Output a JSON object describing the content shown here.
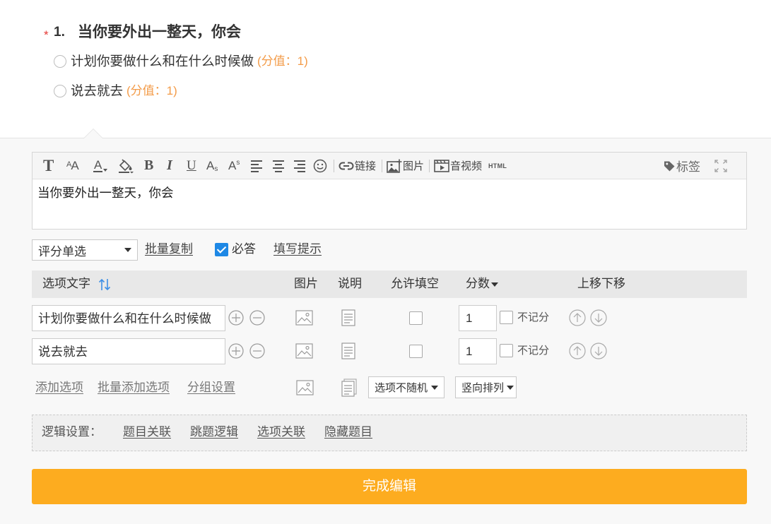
{
  "colors": {
    "accent": "#fdac1f",
    "required": "#e53935",
    "score": "#f39b48",
    "checkbox": "#1e88e5",
    "sort_icon": "#3d8fe6",
    "panel_bg": "#f8f8f8"
  },
  "question": {
    "required_mark": "*",
    "number": "1.",
    "title": "当你要外出一整天，你会",
    "options": [
      {
        "label": "计划你要做什么和在什么时候做",
        "score": "(分值：1)"
      },
      {
        "label": "说去就去",
        "score": "(分值：1)"
      }
    ]
  },
  "toolbar": {
    "tools": [
      {
        "icon": "font-family-icon",
        "glyph": "T"
      },
      {
        "icon": "font-size-icon",
        "glyph": "A",
        "small_glyph": "A"
      },
      {
        "icon": "font-color-icon",
        "glyph": "A"
      },
      {
        "icon": "background-color-icon"
      },
      {
        "icon": "bold-icon",
        "glyph": "B"
      },
      {
        "icon": "italic-icon",
        "glyph": "I"
      },
      {
        "icon": "underline-icon",
        "glyph": "U"
      },
      {
        "icon": "subscript-icon",
        "glyph": "A",
        "small_glyph": "s"
      },
      {
        "icon": "superscript-icon",
        "glyph": "A",
        "small_glyph": "s"
      },
      {
        "icon": "align-left-icon"
      },
      {
        "icon": "align-center-icon"
      },
      {
        "icon": "align-right-icon"
      },
      {
        "icon": "emoji-icon"
      }
    ],
    "link": {
      "icon": "link-icon",
      "label": "链接"
    },
    "image": {
      "icon": "image-icon",
      "label": "图片"
    },
    "media": {
      "icon": "video-icon",
      "label": "音视频"
    },
    "html": {
      "label": "HTML"
    },
    "tag": {
      "icon": "tag-icon",
      "label": "标签"
    },
    "fullscreen": {
      "icon": "fullscreen-icon"
    }
  },
  "editor": {
    "content": "当你要外出一整天，你会"
  },
  "settings": {
    "question_type": "评分单选",
    "batch_copy": "批量复制",
    "required_checked": true,
    "required_label": "必答",
    "fill_hint": "填写提示"
  },
  "table": {
    "headers": {
      "option_text": "选项文字",
      "image": "图片",
      "description": "说明",
      "allow_fill": "允许填空",
      "score": "分数",
      "move": "上移下移"
    },
    "rows": [
      {
        "text": "计划你要做什么和在什么时候做",
        "allow_fill": false,
        "score": "1",
        "no_score_checked": false,
        "no_score_label": "不记分"
      },
      {
        "text": "说去就去",
        "allow_fill": false,
        "score": "1",
        "no_score_checked": false,
        "no_score_label": "不记分"
      }
    ]
  },
  "option_actions": {
    "add_option": "添加选项",
    "batch_add": "批量添加选项",
    "group_settings": "分组设置",
    "random_select": "选项不随机",
    "layout_select": "竖向排列"
  },
  "logic": {
    "label": "逻辑设置：",
    "links": [
      "题目关联",
      "跳题逻辑",
      "选项关联",
      "隐藏题目"
    ]
  },
  "submit_label": "完成编辑"
}
